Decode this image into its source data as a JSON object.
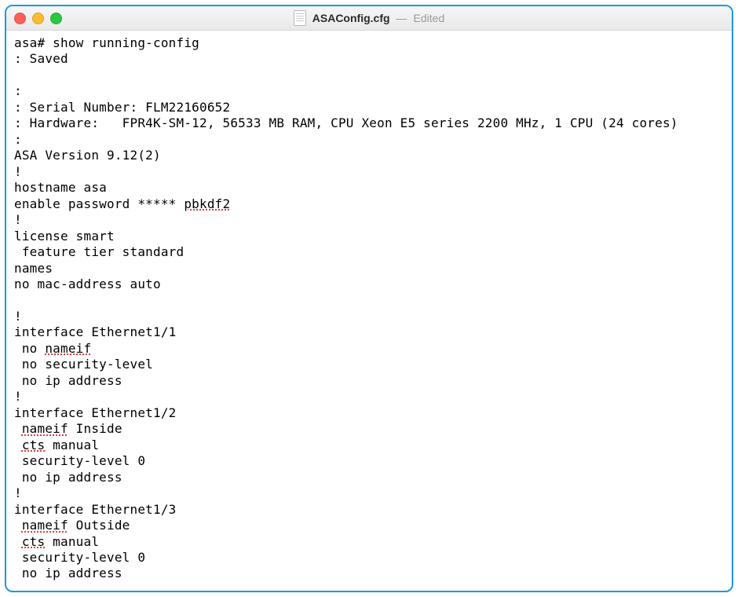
{
  "window": {
    "filename": "ASAConfig.cfg",
    "status": "Edited",
    "separator": "—"
  },
  "config": {
    "prompt": "asa# show running-config",
    "saved": ": Saved",
    "blank1": "",
    "colon": ":",
    "serial": ": Serial Number: FLM22160652",
    "hardware": ": Hardware:   FPR4K-SM-12, 56533 MB RAM, CPU Xeon E5 series 2200 MHz, 1 CPU (24 cores)",
    "colon2": ":",
    "version": "ASA Version 9.12(2)",
    "bang1": "!",
    "hostname": "hostname asa",
    "enable_pre": "enable password ***** ",
    "enable_sp": "pbkdf2",
    "bang2": "!",
    "license": "license smart",
    "feature": " feature tier standard",
    "names": "names",
    "nomac": "no mac-address auto",
    "blank2": "",
    "bang3": "!",
    "if1": "interface Ethernet1/1",
    "if1_no": " no ",
    "if1_nameif": "nameif",
    "if1_sec": " no security-level",
    "if1_ip": " no ip address",
    "bang4": "!",
    "if2": "interface Ethernet1/2",
    "if2_nm_pre": " ",
    "if2_nm_sp": "nameif",
    "if2_nm_post": " Inside",
    "if2_cts_pre": " ",
    "if2_cts_sp": "cts",
    "if2_cts_post": " manual",
    "if2_sec": " security-level 0",
    "if2_ip": " no ip address",
    "bang5": "!",
    "if3": "interface Ethernet1/3",
    "if3_nm_pre": " ",
    "if3_nm_sp": "nameif",
    "if3_nm_post": " Outside",
    "if3_cts_pre": " ",
    "if3_cts_sp": "cts",
    "if3_cts_post": " manual",
    "if3_sec": " security-level 0",
    "if3_ip": " no ip address"
  }
}
